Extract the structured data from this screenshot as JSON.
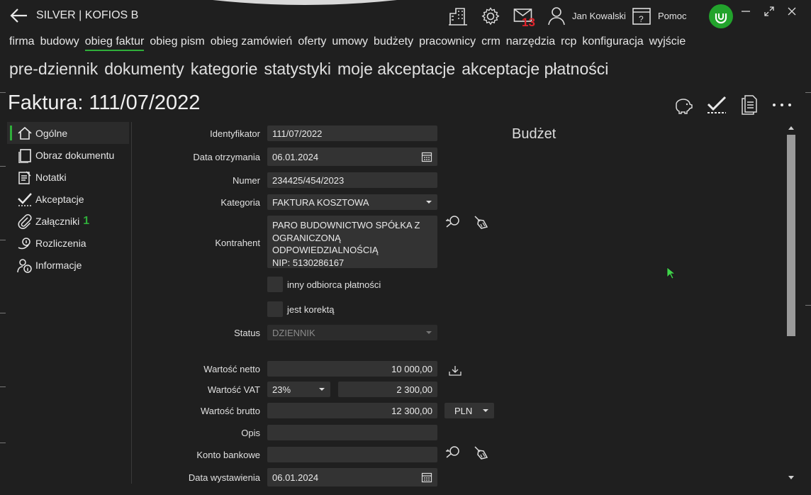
{
  "app": {
    "title": "SILVER | KOFIOS B"
  },
  "header": {
    "mail_count": "13",
    "user_name": "Jan Kowalski",
    "help_label": "Pomoc"
  },
  "nav_top": [
    "firma",
    "budowy",
    "obieg faktur",
    "obieg pism",
    "obieg zamówień",
    "oferty",
    "umowy",
    "budżety",
    "pracownicy",
    "crm",
    "narzędzia",
    "rcp",
    "konfiguracja",
    "wyjście"
  ],
  "nav_sub": [
    "pre-dziennik",
    "dokumenty",
    "kategorie",
    "statystyki",
    "moje akceptacje",
    "akceptacje płatności"
  ],
  "document": {
    "title": "Faktura: 111/07/2022"
  },
  "sidebar": {
    "items": [
      {
        "label": "Ogólne",
        "icon": "home-icon"
      },
      {
        "label": "Obraz dokumentu",
        "icon": "document-image-icon"
      },
      {
        "label": "Notatki",
        "icon": "notes-icon"
      },
      {
        "label": "Akceptacje",
        "icon": "checkmark-icon"
      },
      {
        "label": "Załączniki",
        "icon": "paperclip-icon",
        "badge": "1"
      },
      {
        "label": "Rozliczenia",
        "icon": "settlement-icon"
      },
      {
        "label": "Informacje",
        "icon": "person-info-icon"
      }
    ]
  },
  "form": {
    "identyfikator": {
      "label": "Identyfikator",
      "value": "111/07/2022"
    },
    "data_otrzymania": {
      "label": "Data otrzymania",
      "value": "06.01.2024"
    },
    "numer": {
      "label": "Numer",
      "value": "234425/454/2023"
    },
    "kategoria": {
      "label": "Kategoria",
      "value": "FAKTURA KOSZTOWA"
    },
    "kontrahent": {
      "label": "Kontrahent",
      "lines": [
        "PARO BUDOWNICTWO SPÓŁKA Z",
        "OGRANICZONĄ",
        "ODPOWIEDZIALNOŚCIĄ",
        "NIP: 5130286167"
      ]
    },
    "inny_odbiorca": {
      "label": "inny odbiorca płatności"
    },
    "jest_korekta": {
      "label": "jest korektą"
    },
    "status": {
      "label": "Status",
      "value": "DZIENNIK"
    },
    "wartosc_netto": {
      "label": "Wartość netto",
      "value": "10 000,00"
    },
    "wartosc_vat": {
      "label": "Wartość VAT",
      "rate": "23%",
      "value": "2 300,00"
    },
    "wartosc_brutto": {
      "label": "Wartość brutto",
      "value": "12 300,00",
      "currency": "PLN"
    },
    "opis": {
      "label": "Opis",
      "value": ""
    },
    "konto_bankowe": {
      "label": "Konto bankowe",
      "value": ""
    },
    "data_wystawienia": {
      "label": "Data wystawienia",
      "value": "06.01.2024"
    }
  },
  "budget": {
    "title": "Budżet"
  },
  "colors": {
    "accent": "#2fae3a",
    "badge_red": "#e0242c",
    "background": "#1f1f1f",
    "field": "#333333"
  }
}
